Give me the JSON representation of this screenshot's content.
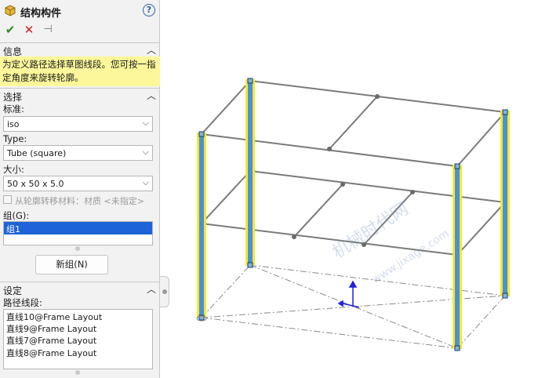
{
  "panel": {
    "title": "结构构件",
    "title_icon": "structural-member-icon",
    "help_icon": "help-icon",
    "help_glyph": "?",
    "actions": {
      "ok_glyph": "✔",
      "cancel_glyph": "✕",
      "pin_glyph": "⊣"
    },
    "info": {
      "header": "信息",
      "message": "为定义路径选择草图线段。您可按一指定角度来旋转轮廓。"
    },
    "selection": {
      "header": "选择",
      "standard_label": "标准:",
      "standard_value": "iso",
      "type_label": "Type:",
      "type_value": "Tube (square)",
      "size_label": "大小:",
      "size_value": "50 x 50 x 5.0",
      "transfer_material_label": "从轮廓转移材料：材质 <未指定>",
      "transfer_material_checked": false,
      "groups_label": "组(G):",
      "groups": [
        "组1"
      ],
      "new_group_button": "新组(N)"
    },
    "settings": {
      "header": "设定",
      "path_segments_label": "路径线段:",
      "path_segments": [
        "直线10@Frame Layout",
        "直线9@Frame Layout",
        "直线7@Frame Layout",
        "直线8@Frame Layout"
      ]
    },
    "chevron_glyph": "︿"
  },
  "watermark": {
    "line1": "机械时代网",
    "line2": "www.jixage.com"
  },
  "colors": {
    "selection_highlight": "#f2ea2a",
    "member_fill": "#4a90d9",
    "frame_line": "#7a7a7a",
    "info_background": "#fbf79a",
    "list_selected": "#1e63d8"
  }
}
